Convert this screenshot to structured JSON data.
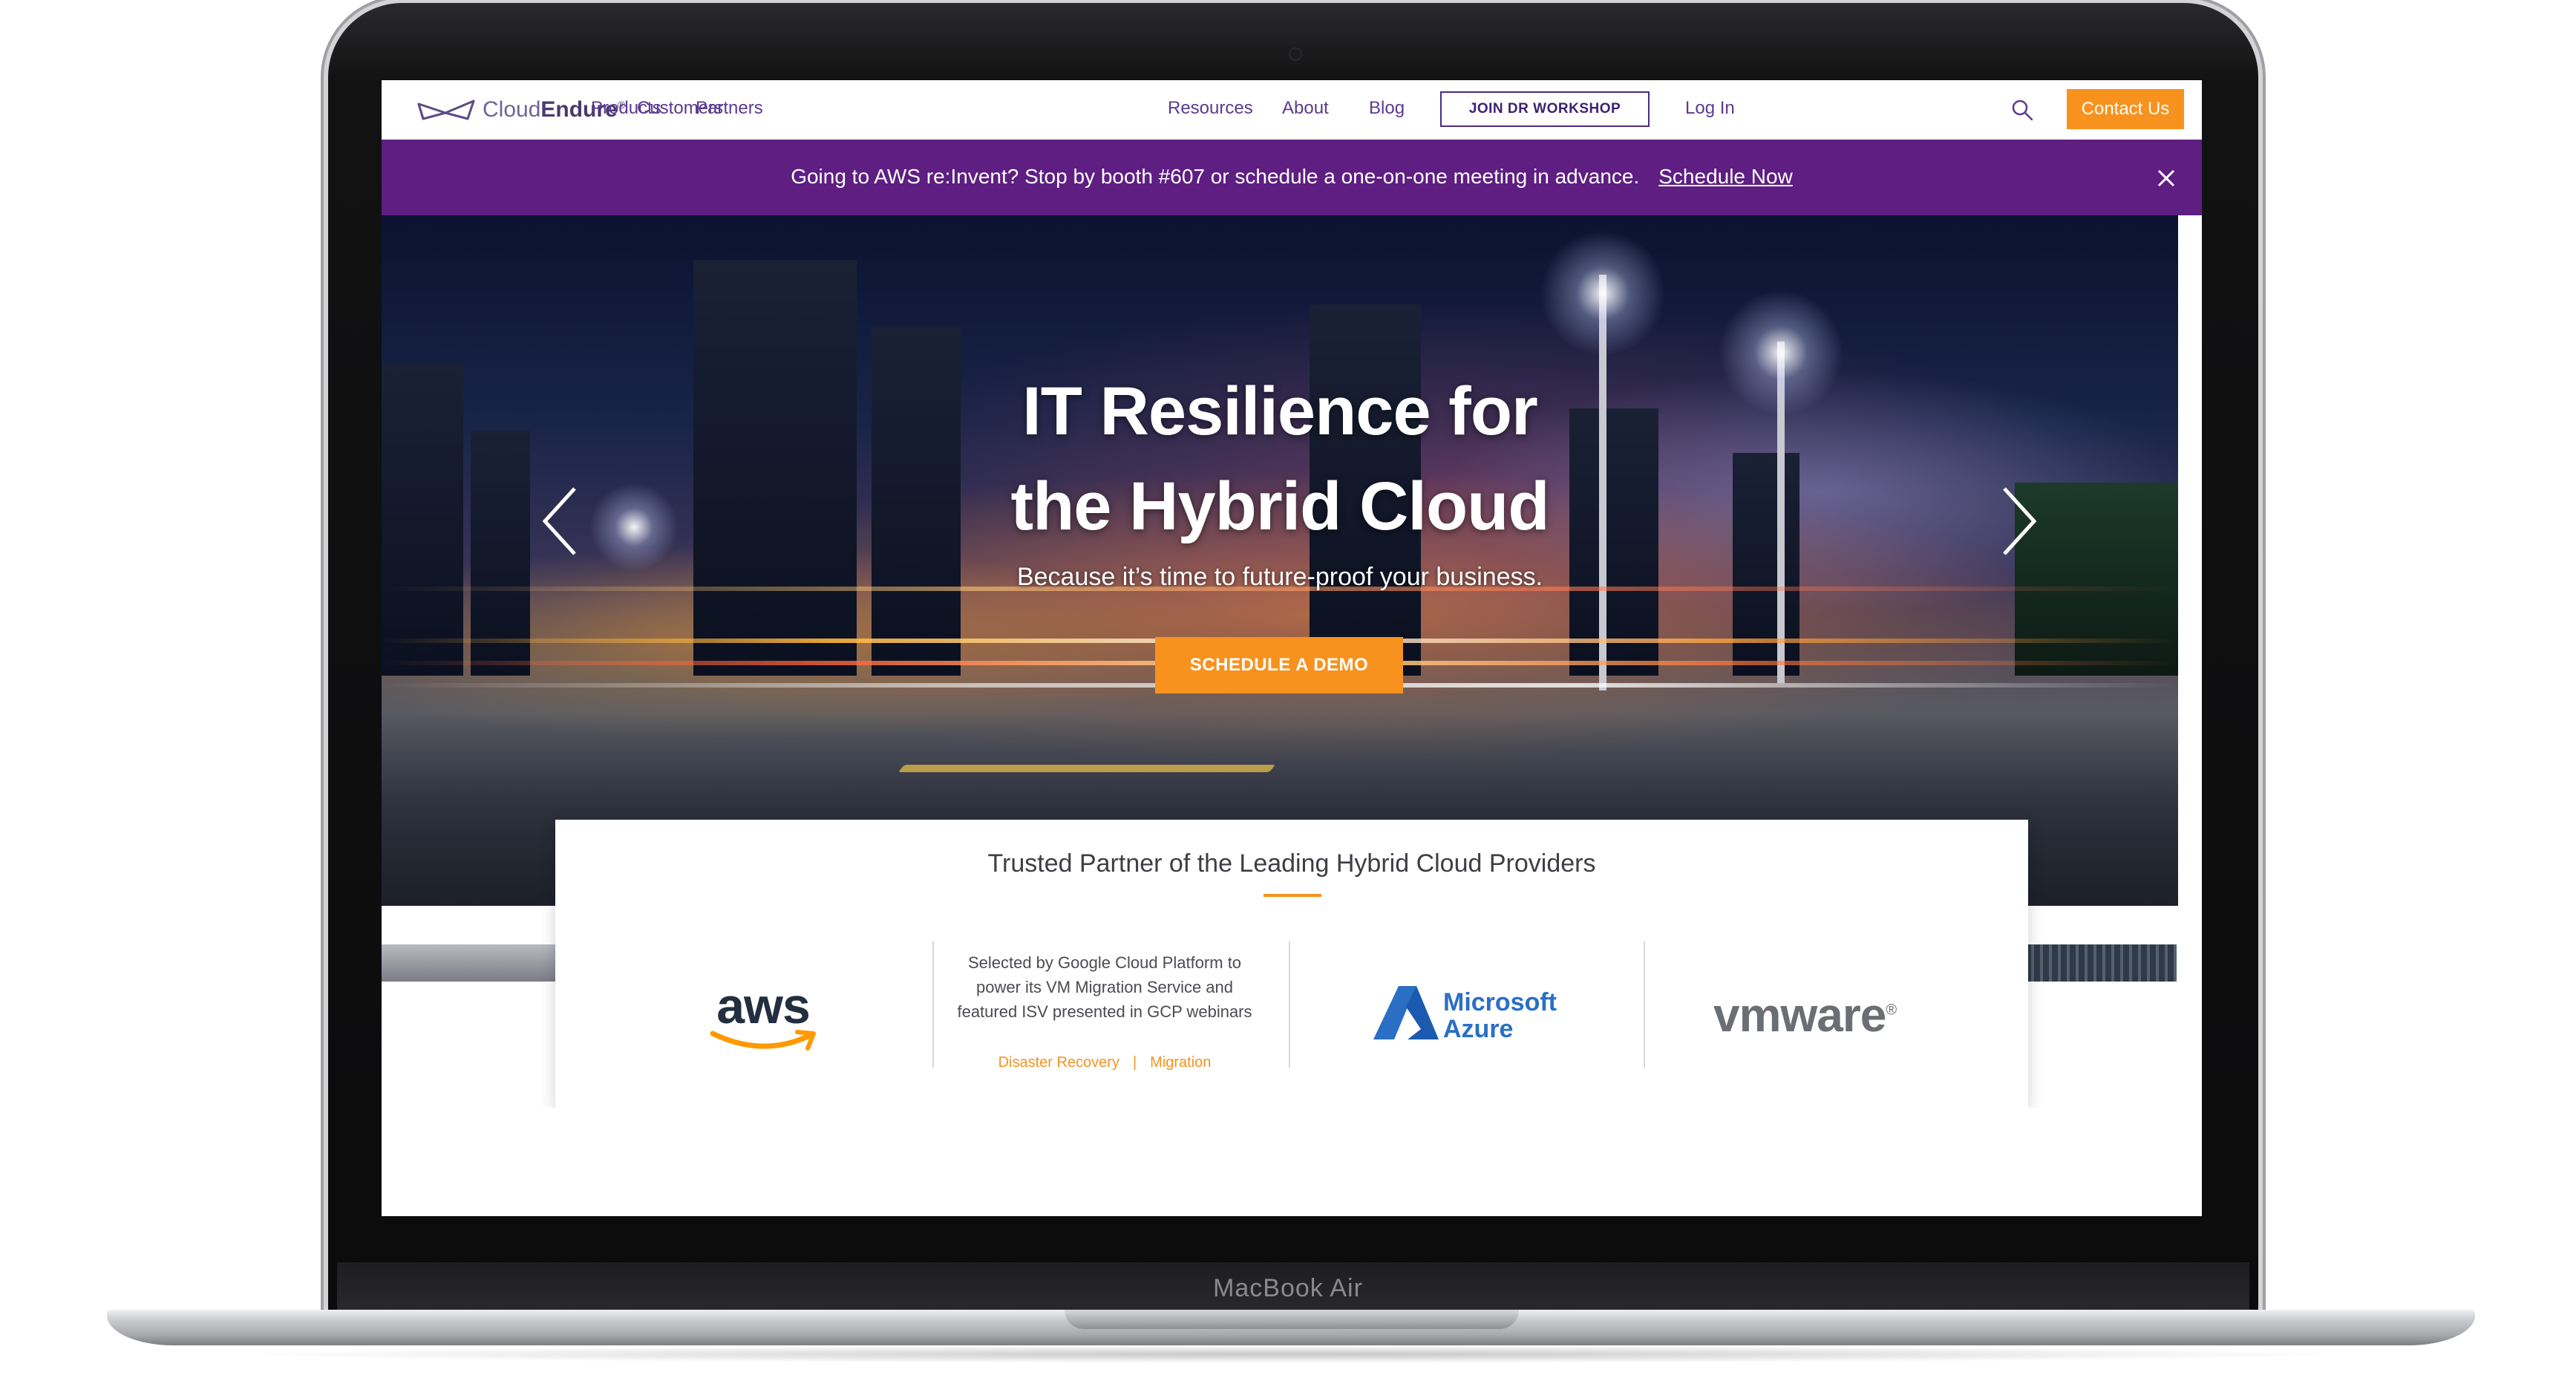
{
  "device": {
    "label": "MacBook Air"
  },
  "nav": {
    "logo_light": "Cloud",
    "logo_bold": "Endure",
    "logo_mark": "®",
    "items": [
      "Products",
      "Customers",
      "Partners",
      "Resources",
      "About",
      "Blog"
    ],
    "workshop_label": "JOIN DR WORKSHOP",
    "login_label": "Log In",
    "contact_label": "Contact Us"
  },
  "announcement": {
    "text": "Going to AWS re:Invent? Stop by booth #607 or schedule a one-on-one meeting in advance.",
    "link_label": "Schedule Now"
  },
  "hero": {
    "title_line1": "IT Resilience for",
    "title_line2": "the Hybrid Cloud",
    "subtitle": "Because it’s time to future-proof your business.",
    "cta_label": "SCHEDULE A DEMO"
  },
  "partners": {
    "title": "Trusted Partner of the Leading Hybrid Cloud Providers",
    "aws_label": "aws",
    "gcp_text": "Selected by Google Cloud Platform to power its VM Migration Service and featured ISV presented in GCP webinars",
    "gcp_link1": "Disaster Recovery",
    "gcp_separator": "|",
    "gcp_link2": "Migration",
    "azure_line1": "Microsoft",
    "azure_line2": "Azure",
    "vmware_label": "vmware",
    "vmware_mark": "®"
  },
  "colors": {
    "accent_orange": "#f7921e",
    "brand_purple": "#5e1e82",
    "nav_purple": "#5b3a8f",
    "azure_blue": "#2a6fc4"
  },
  "icons": [
    "search-icon",
    "close-icon",
    "chevron-left-icon",
    "chevron-right-icon",
    "cloudendure-logo-icon",
    "azure-logo-icon",
    "aws-smile-icon"
  ]
}
